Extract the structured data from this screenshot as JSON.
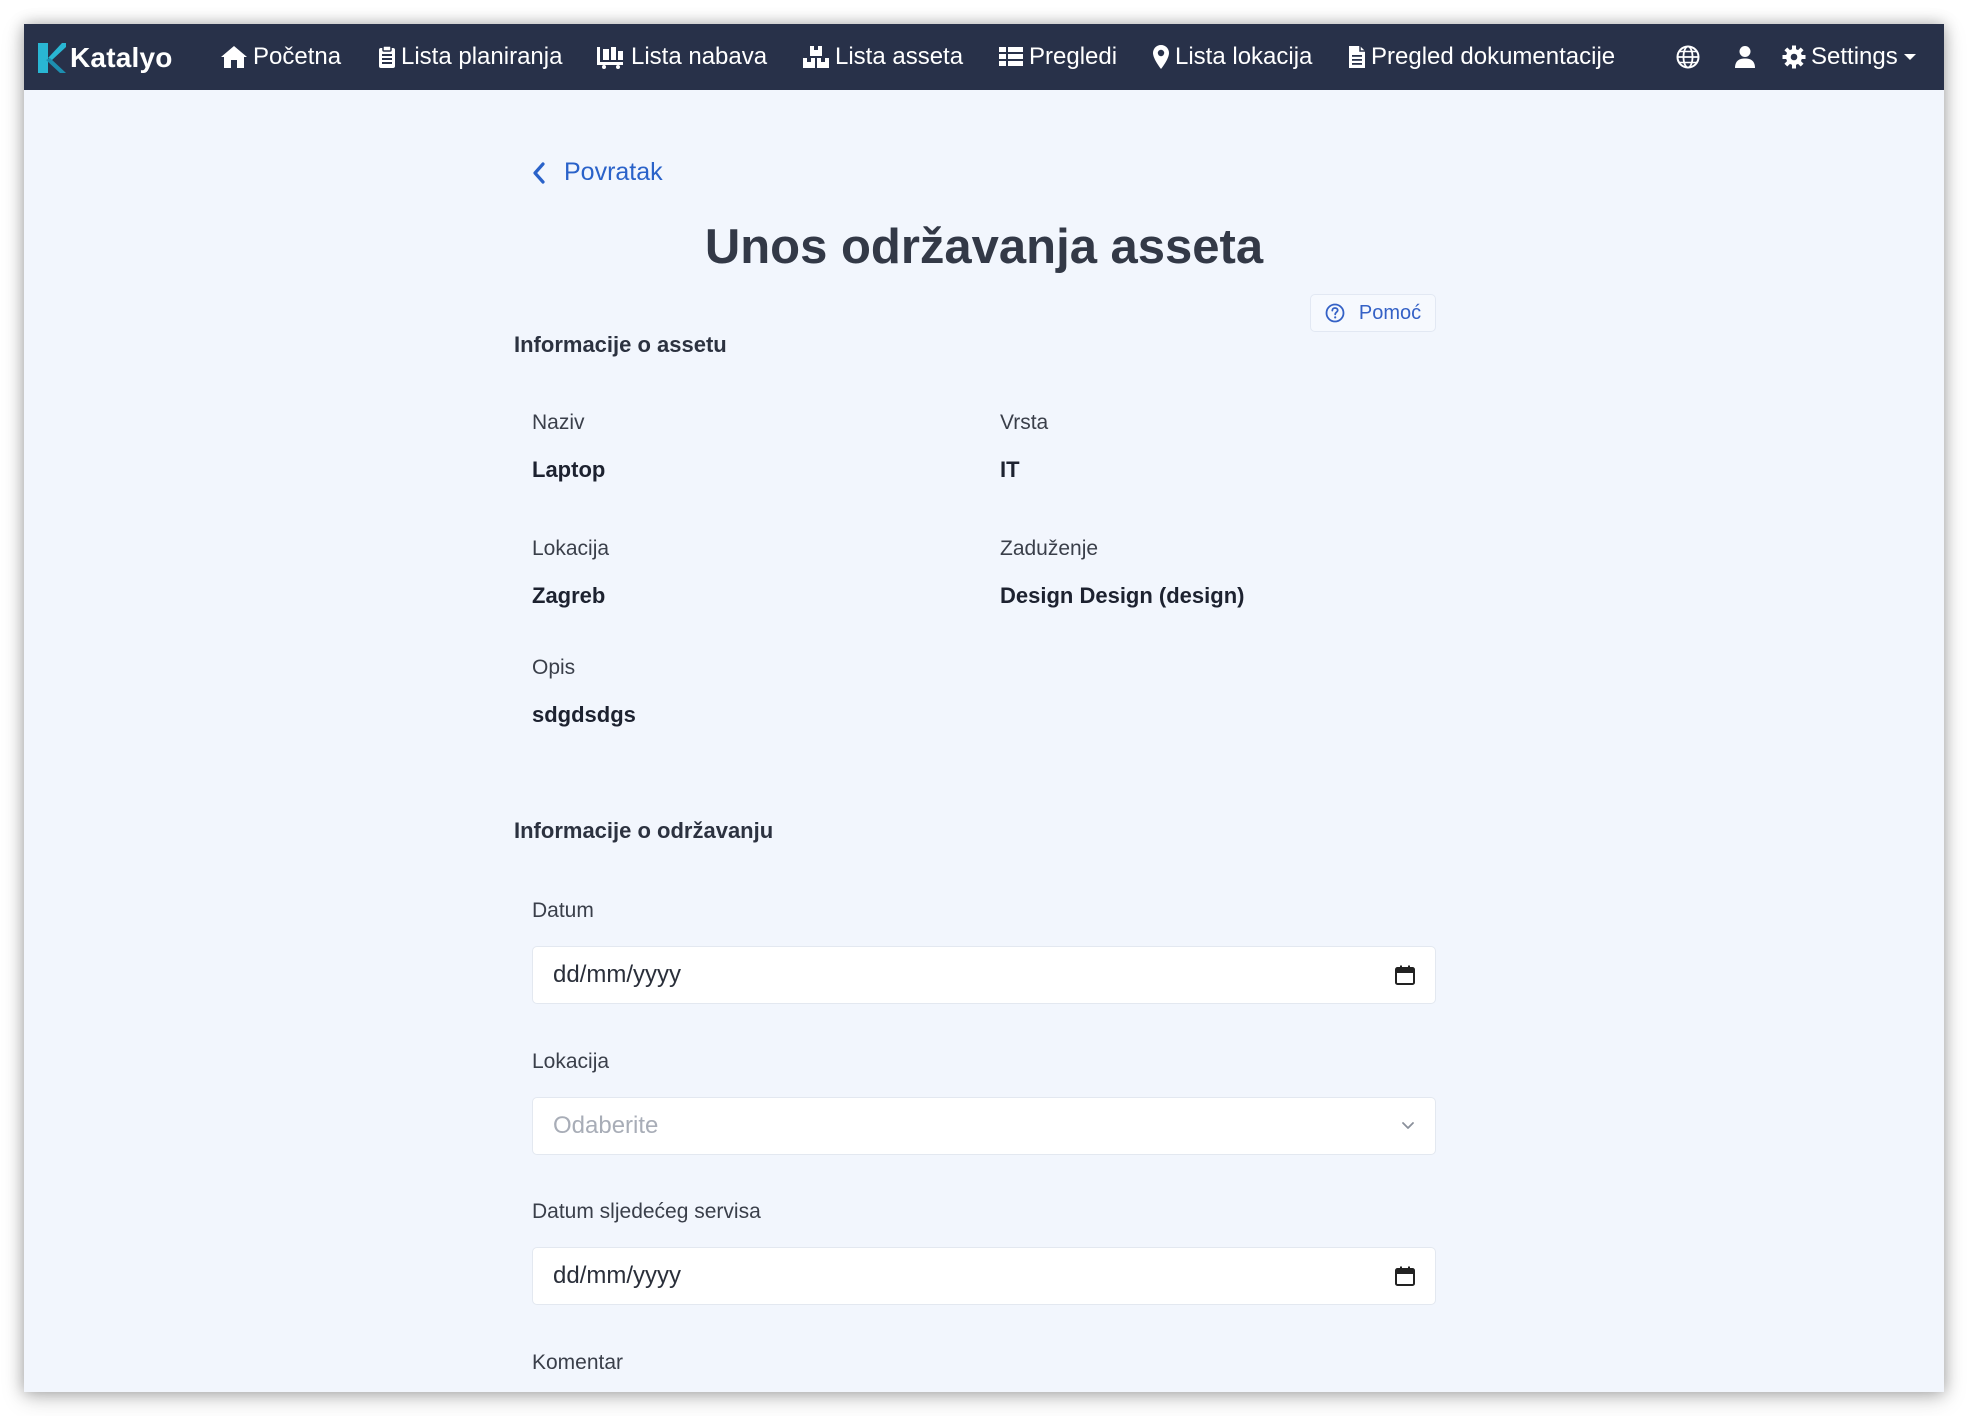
{
  "brand": {
    "name": "Katalyo"
  },
  "nav": {
    "items": [
      {
        "label": "Početna",
        "icon": "home-icon"
      },
      {
        "label": "Lista planiranja",
        "icon": "clipboard-icon"
      },
      {
        "label": "Lista nabava",
        "icon": "cart-icon"
      },
      {
        "label": "Lista asseta",
        "icon": "boxes-icon"
      },
      {
        "label": "Pregledi",
        "icon": "table-icon"
      },
      {
        "label": "Lista lokacija",
        "icon": "map-marker-icon"
      },
      {
        "label": "Pregled dokumentacije",
        "icon": "file-icon"
      }
    ],
    "settings_label": "Settings"
  },
  "page": {
    "back_label": "Povratak",
    "title": "Unos održavanja asseta",
    "help_label": "Pomoć"
  },
  "asset_info": {
    "section_title": "Informacije o assetu",
    "fields": [
      {
        "label": "Naziv",
        "value": "Laptop"
      },
      {
        "label": "Vrsta",
        "value": "IT"
      },
      {
        "label": "Lokacija",
        "value": "Zagreb"
      },
      {
        "label": "Zaduženje",
        "value": "Design Design (design)"
      },
      {
        "label": "Opis",
        "value": "sdgdsdgs"
      }
    ]
  },
  "maintenance_form": {
    "section_title": "Informacije o održavanju",
    "datum": {
      "label": "Datum",
      "value": "dd/mm/yyyy"
    },
    "lokacija": {
      "label": "Lokacija",
      "placeholder": "Odaberite"
    },
    "next_service": {
      "label": "Datum sljedećeg servisa",
      "value": "dd/mm/yyyy"
    },
    "komentar": {
      "label": "Komentar"
    }
  },
  "colors": {
    "navbar": "#283149",
    "page_bg": "#f2f6fd",
    "link": "#2a62c9",
    "brand_accent": "#29b6d3"
  }
}
